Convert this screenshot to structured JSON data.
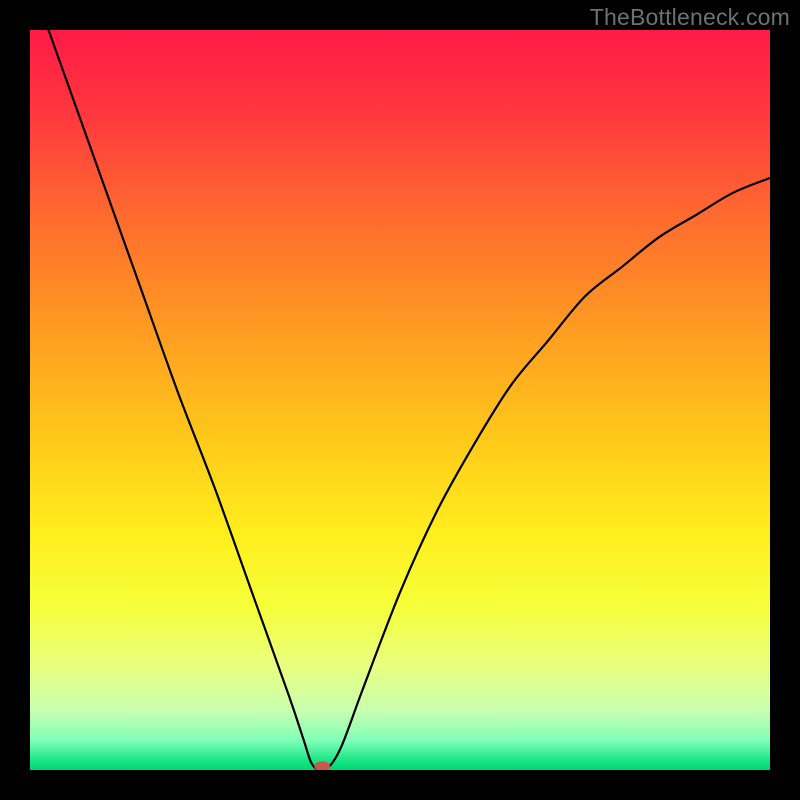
{
  "watermark": "TheBottleneck.com",
  "chart_data": {
    "type": "line",
    "title": "",
    "xlabel": "",
    "ylabel": "",
    "xlim": [
      0,
      100
    ],
    "ylim": [
      0,
      100
    ],
    "grid": false,
    "legend": null,
    "series": [
      {
        "name": "bottleneck-curve",
        "color": "#000000",
        "x": [
          0,
          5,
          10,
          15,
          20,
          25,
          30,
          35,
          37,
          38,
          39,
          40,
          42,
          45,
          50,
          55,
          60,
          65,
          70,
          75,
          80,
          85,
          90,
          95,
          100
        ],
        "y": [
          107,
          93,
          79,
          65,
          51,
          38,
          24,
          10,
          4,
          1,
          0,
          0,
          3,
          11,
          24,
          35,
          44,
          52,
          58,
          64,
          68,
          72,
          75,
          78,
          80
        ]
      }
    ],
    "marker": {
      "name": "optimum-point",
      "x": 39.5,
      "y": 0.5,
      "color": "#c55a4a",
      "rx": 8,
      "ry": 5
    },
    "background_gradient": {
      "stops": [
        {
          "offset": 0.0,
          "color": "#ff1a48"
        },
        {
          "offset": 0.12,
          "color": "#ff3a3d"
        },
        {
          "offset": 0.25,
          "color": "#ff6a2f"
        },
        {
          "offset": 0.4,
          "color": "#ff9a22"
        },
        {
          "offset": 0.55,
          "color": "#ffc81a"
        },
        {
          "offset": 0.68,
          "color": "#ffee1d"
        },
        {
          "offset": 0.78,
          "color": "#f5ff3a"
        },
        {
          "offset": 0.86,
          "color": "#e8ff80"
        },
        {
          "offset": 0.92,
          "color": "#c8ffb0"
        },
        {
          "offset": 0.96,
          "color": "#80ffb8"
        },
        {
          "offset": 0.985,
          "color": "#20e78a"
        },
        {
          "offset": 1.0,
          "color": "#00d672"
        }
      ]
    }
  }
}
